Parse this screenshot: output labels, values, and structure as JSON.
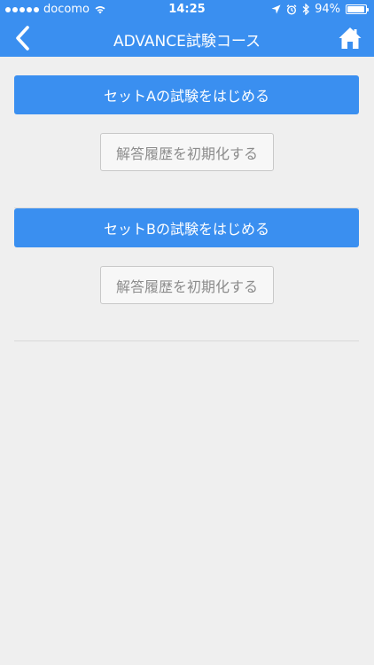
{
  "status_bar": {
    "carrier": "docomo",
    "time": "14:25",
    "battery": "94%",
    "battery_level": 0.94
  },
  "nav": {
    "title": "ADVANCE試験コース",
    "back_icon": "chevron-left-icon",
    "home_icon": "home-icon"
  },
  "sections": [
    {
      "start_label": "セットAの試験をはじめる",
      "reset_label": "解答履歴を初期化する"
    },
    {
      "start_label": "セットBの試験をはじめる",
      "reset_label": "解答履歴を初期化する"
    }
  ],
  "colors": {
    "accent": "#3a8ff0",
    "background": "#efefef"
  }
}
